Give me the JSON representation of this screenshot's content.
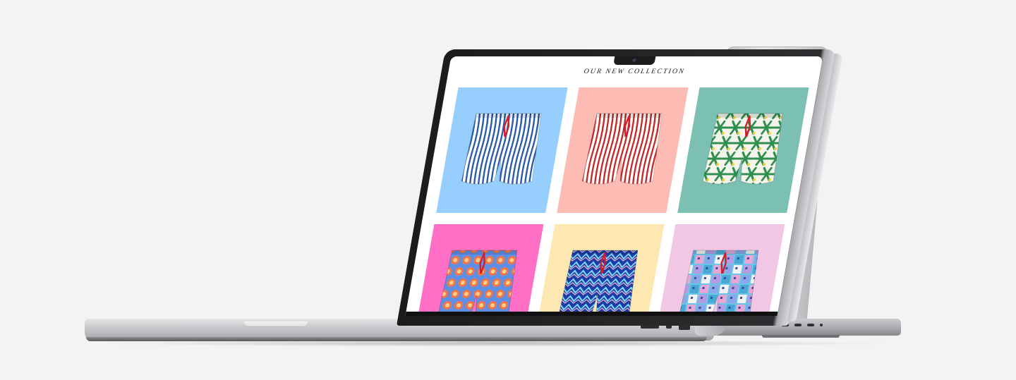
{
  "page": {
    "heading": "OUR NEW COLLECTION"
  },
  "collection": {
    "items": [
      {
        "background": "#96cffe",
        "pattern": "stripes",
        "base": "#ffffff",
        "accent": "#2a5aa8",
        "label": "blue-stripe-swim-shorts"
      },
      {
        "background": "#fdbcb3",
        "pattern": "stripes",
        "base": "#ffffff",
        "accent": "#c42a2a",
        "label": "red-stripe-swim-shorts"
      },
      {
        "background": "#7bc0b2",
        "pattern": "palms",
        "base": "#f4f4ec",
        "accent": "#2e8f4f",
        "label": "palm-print-swim-shorts"
      },
      {
        "background": "#ff6fc6",
        "pattern": "dots",
        "base": "#5e8fe6",
        "accent": "#f2754a",
        "label": "sun-dot-swim-shorts"
      },
      {
        "background": "#fde8b2",
        "pattern": "waves",
        "base": "#1b3ea8",
        "accent": "#7fd6ff",
        "label": "wave-print-swim-shorts"
      },
      {
        "background": "#f2c7e5",
        "pattern": "blocks",
        "base": "#68c7e8",
        "accent": "#f3f3f3",
        "label": "city-block-swim-shorts"
      }
    ]
  },
  "colors": {
    "page_background": "#f3f3f3",
    "drawstring": "#d21f2b"
  },
  "icons": [
    "camera-icon",
    "sd-card-slot-icon",
    "usb-c-port-icon",
    "hdmi-port-icon"
  ]
}
